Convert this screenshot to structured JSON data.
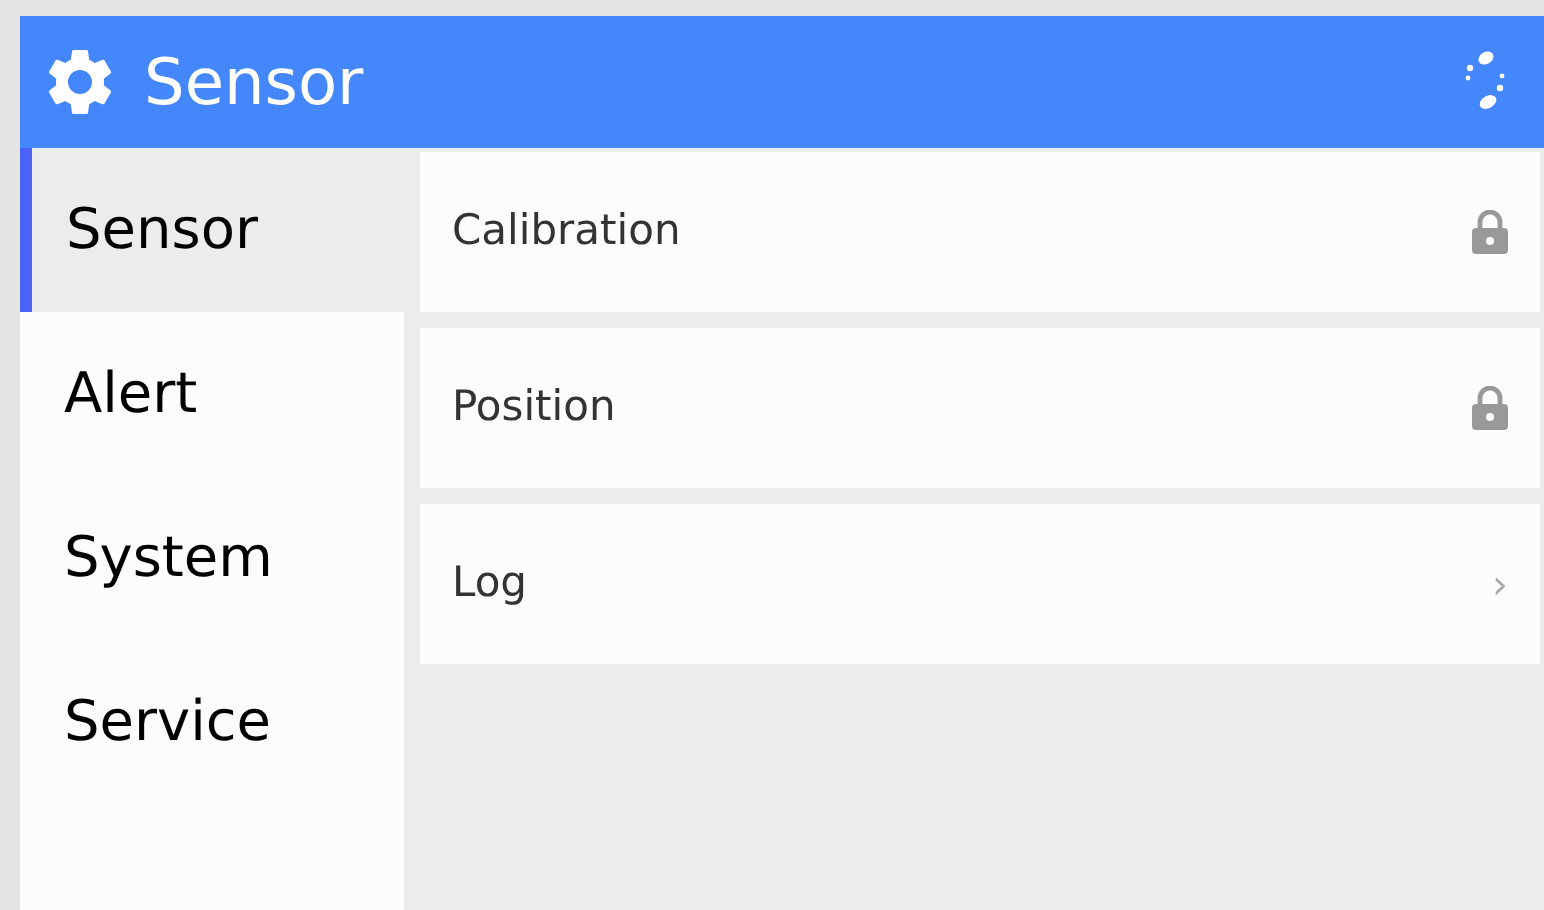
{
  "header": {
    "title": "Sensor"
  },
  "sidebar": {
    "items": [
      {
        "label": "Sensor",
        "selected": true
      },
      {
        "label": "Alert",
        "selected": false
      },
      {
        "label": "System",
        "selected": false
      },
      {
        "label": "Service",
        "selected": false
      }
    ]
  },
  "settings": [
    {
      "label": "Calibration",
      "kind": "locked"
    },
    {
      "label": "Position",
      "kind": "locked"
    },
    {
      "label": "Log",
      "kind": "link",
      "chevron": "›"
    }
  ]
}
